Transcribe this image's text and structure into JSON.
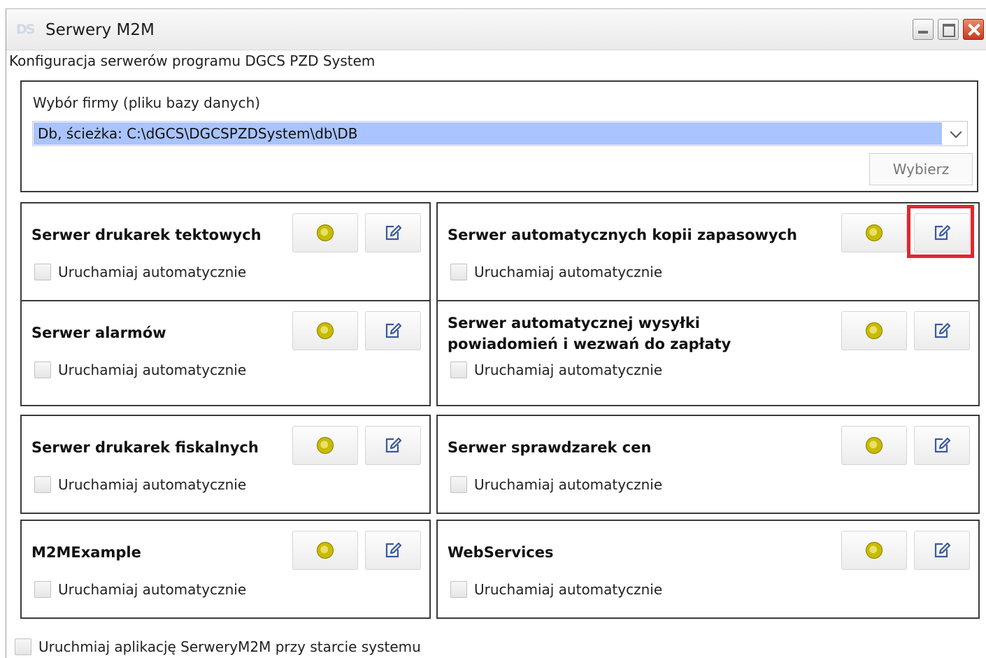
{
  "window": {
    "title": "Serwery M2M",
    "subtitle": "Konfiguracja serwerów programu DGCS PZD System"
  },
  "company_picker": {
    "label": "Wybór firmy (pliku bazy danych)",
    "selected": "Db, ścieżka: C:\\dGCS\\DGCSPZDSystem\\db\\DB",
    "choose_label": "Wybierz"
  },
  "servers": [
    {
      "title": "Serwer drukarek tektowych",
      "auto_label": "Uruchamiaj automatycznie",
      "auto": false
    },
    {
      "title": "Serwer automatycznych kopii zapasowych",
      "auto_label": "Uruchamiaj automatycznie",
      "auto": false,
      "highlighted": "edit-button"
    },
    {
      "title": "Serwer alarmów",
      "auto_label": "Uruchamiaj automatycznie",
      "auto": false
    },
    {
      "title": "Serwer automatycznej wysyłki\npowiadomień i wezwań do zapłaty",
      "auto_label": "Uruchamiaj automatycznie",
      "auto": false
    },
    {
      "title": "Serwer drukarek fiskalnych",
      "auto_label": "Uruchamiaj automatycznie",
      "auto": false
    },
    {
      "title": "Serwer sprawdzarek cen",
      "auto_label": "Uruchamiaj automatycznie",
      "auto": false
    },
    {
      "title": "M2MExample",
      "auto_label": "Uruchamiaj automatycznie",
      "auto": false
    },
    {
      "title": "WebServices",
      "auto_label": "Uruchamiaj automatycznie",
      "auto": false
    }
  ],
  "footer": {
    "autostart_label": "Uruchmiaj aplikację SerweryM2M przy starcie systemu",
    "autostart": false
  },
  "colors": {
    "selection": "#a9c4ff",
    "status_dot": "#c9bb00",
    "edit_icon": "#3a5a9e",
    "highlight": "#e4252d"
  },
  "icons": {
    "start": "yellow-dot-icon",
    "edit": "edit-pencil-icon",
    "app": "dgcs-logo-icon"
  }
}
